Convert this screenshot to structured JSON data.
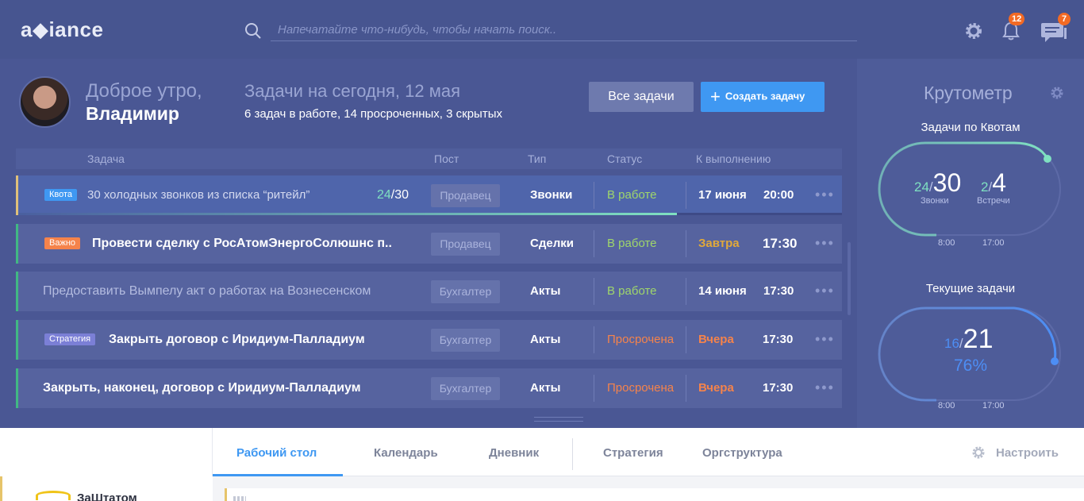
{
  "app": {
    "logo": "a◆iance"
  },
  "search": {
    "placeholder": "Напечатайте что-нибудь, чтобы начать поиск.."
  },
  "header_icons": {
    "notifications_count": "12",
    "messages_count": "7",
    "settings_icon": "gear-icon",
    "notifications_icon": "bell-icon",
    "messages_icon": "chat-icon"
  },
  "greeting": {
    "line1": "Доброе утро,",
    "name": "Владимир"
  },
  "tasks_summary": {
    "title": "Задачи на сегодня, 12 мая",
    "subtitle": "6 задач в работе, 14 просроченных, 3 скрытых"
  },
  "buttons": {
    "all_tasks": "Все задачи",
    "create_task": "Создать задачу"
  },
  "table": {
    "headers": [
      "Задача",
      "Пост",
      "Тип",
      "Статус",
      "К выполнению"
    ],
    "rows": [
      {
        "tag": "Квота",
        "title": "30 холодных звонков из списка “ритейл”",
        "progress_done": "24",
        "progress_total": "/30",
        "post": "Продавец",
        "type": "Звонки",
        "status": "В работе",
        "date": "17 июня",
        "time": "20:00",
        "progress_fraction": 0.8
      },
      {
        "tag": "Важно",
        "title": "Провести сделку с РосАтомЭнергоСолюшнс п..",
        "post": "Продавец",
        "type": "Сделки",
        "status": "В работе",
        "date": "Завтра",
        "time": "17:30"
      },
      {
        "tag": "",
        "title": "Предоставить Вымпелу акт о работах на Вознесенском",
        "post": "Бухгалтер",
        "type": "Акты",
        "status": "В работе",
        "date": "14 июня",
        "time": "17:30"
      },
      {
        "tag": "Стратегия",
        "title": "Закрыть договор с Иридиум-Палладиум",
        "post": "Бухгалтер",
        "type": "Акты",
        "status": "Просрочена",
        "date": "Вчера",
        "time": "17:30"
      },
      {
        "tag": "",
        "title": "Закрыть, наконец, договор с Иридиум-Палладиум",
        "post": "Бухгалтер",
        "type": "Акты",
        "status": "Просрочена",
        "date": "Вчера",
        "time": "17:30"
      }
    ],
    "more_label": "•••"
  },
  "side": {
    "title": "Крутометр",
    "gauge1": {
      "label": "Задачи по Квотам",
      "calls_done": "24",
      "calls_total": "30",
      "calls_label": "Звонки",
      "meetings_done": "2",
      "meetings_total": "4",
      "meetings_label": "Встречи",
      "time_start": "8:00",
      "time_end": "17:00"
    },
    "gauge2": {
      "label": "Текущие задачи",
      "done": "16",
      "total": "21",
      "percent": "76%",
      "time_start": "8:00",
      "time_end": "17:00"
    }
  },
  "bottom": {
    "tabs": [
      "Рабочий стол",
      "Календарь",
      "Дневник",
      "Стратегия",
      "Оргструктура"
    ],
    "setup": "Настроить",
    "company": "ЗаШтатом"
  },
  "colors": {
    "accent": "#3f98f2",
    "green": "#9fd66b",
    "orange": "#f5834b",
    "gold": "#e1a93a",
    "bg": "#4a5794"
  }
}
